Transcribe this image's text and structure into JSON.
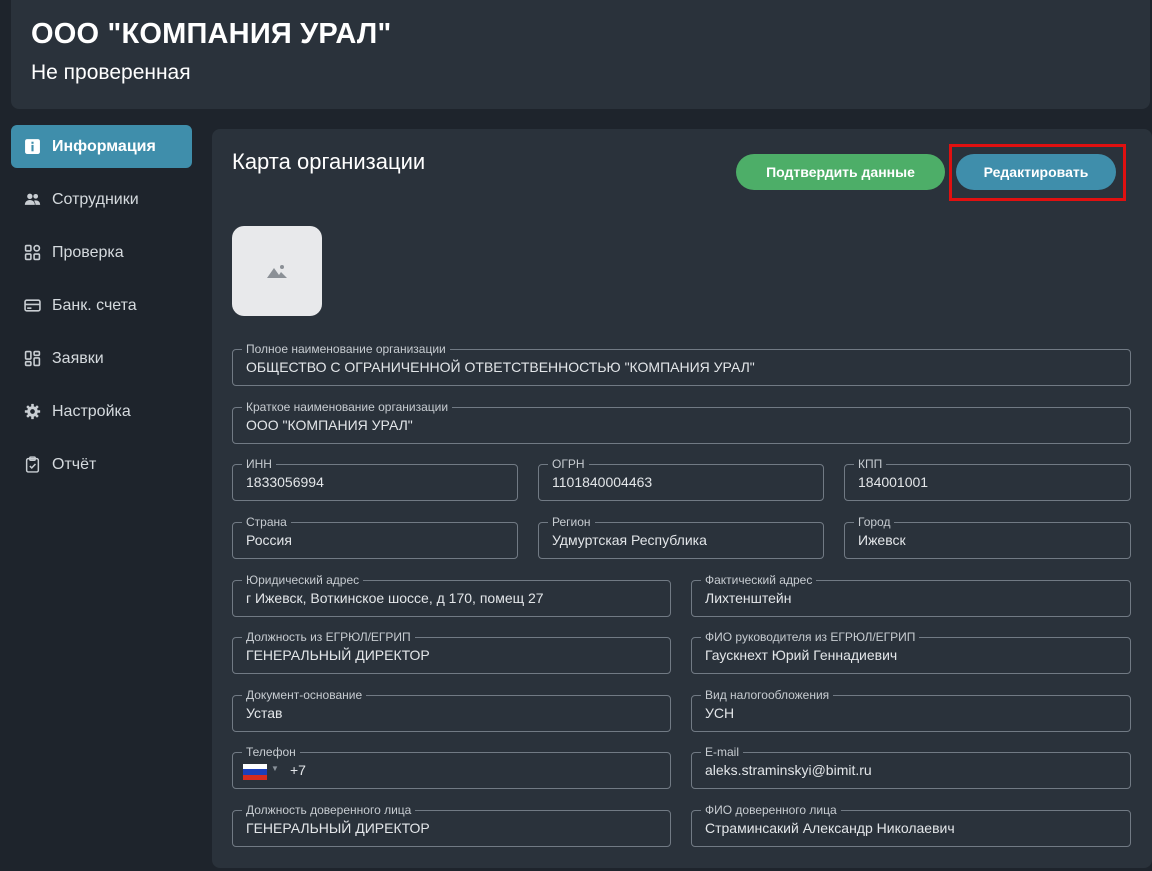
{
  "header": {
    "title": "ООО \"КОМПАНИЯ УРАЛ\"",
    "subtitle": "Не проверенная"
  },
  "sidebar": {
    "items": [
      {
        "label": "Информация",
        "icon": "info-icon",
        "active": true
      },
      {
        "label": "Сотрудники",
        "icon": "users-icon",
        "active": false
      },
      {
        "label": "Проверка",
        "icon": "check-grid-icon",
        "active": false
      },
      {
        "label": "Банк. счета",
        "icon": "card-icon",
        "active": false
      },
      {
        "label": "Заявки",
        "icon": "requests-icon",
        "active": false
      },
      {
        "label": "Настройка",
        "icon": "gear-icon",
        "active": false
      },
      {
        "label": "Отчёт",
        "icon": "clipboard-icon",
        "active": false
      }
    ]
  },
  "card": {
    "title": "Карта организации",
    "confirm_label": "Подтвердить данные",
    "edit_label": "Редактировать"
  },
  "fields": {
    "full_name": {
      "label": "Полное наименование организации",
      "value": "ОБЩЕСТВО С ОГРАНИЧЕННОЙ ОТВЕТСТВЕННОСТЬЮ \"КОМПАНИЯ УРАЛ\""
    },
    "short_name": {
      "label": "Краткое наименование организации",
      "value": "ООО \"КОМПАНИЯ УРАЛ\""
    },
    "inn": {
      "label": "ИНН",
      "value": "1833056994"
    },
    "ogrn": {
      "label": "ОГРН",
      "value": "1101840004463"
    },
    "kpp": {
      "label": "КПП",
      "value": "184001001"
    },
    "country": {
      "label": "Страна",
      "value": "Россия"
    },
    "region": {
      "label": "Регион",
      "value": "Удмуртская Республика"
    },
    "city": {
      "label": "Город",
      "value": "Ижевск"
    },
    "legal_address": {
      "label": "Юридический адрес",
      "value": "г Ижевск, Воткинское шоссе, д 170, помещ 27"
    },
    "actual_address": {
      "label": "Фактический адрес",
      "value": "Лихтенштейн"
    },
    "position_egrul": {
      "label": "Должность из ЕГРЮЛ/ЕГРИП",
      "value": "ГЕНЕРАЛЬНЫЙ ДИРЕКТОР"
    },
    "head_name_egrul": {
      "label": "ФИО руководителя из ЕГРЮЛ/ЕГРИП",
      "value": "Гаускнехт Юрий Геннадиевич"
    },
    "base_document": {
      "label": "Документ-основание",
      "value": "Устав"
    },
    "tax_type": {
      "label": "Вид налогообложения",
      "value": "УСН"
    },
    "phone": {
      "label": "Телефон",
      "value": "+7"
    },
    "email": {
      "label": "E-mail",
      "value": "aleks.straminskyi@bimit.ru"
    },
    "proxy_position": {
      "label": "Должность доверенного лица",
      "value": "ГЕНЕРАЛЬНЫЙ ДИРЕКТОР"
    },
    "proxy_name": {
      "label": "ФИО доверенного лица",
      "value": "Страминсакий Александр Николаевич"
    }
  },
  "colors": {
    "accent": "#3f8eab",
    "confirm": "#4dae68",
    "highlight": "#e01010"
  }
}
